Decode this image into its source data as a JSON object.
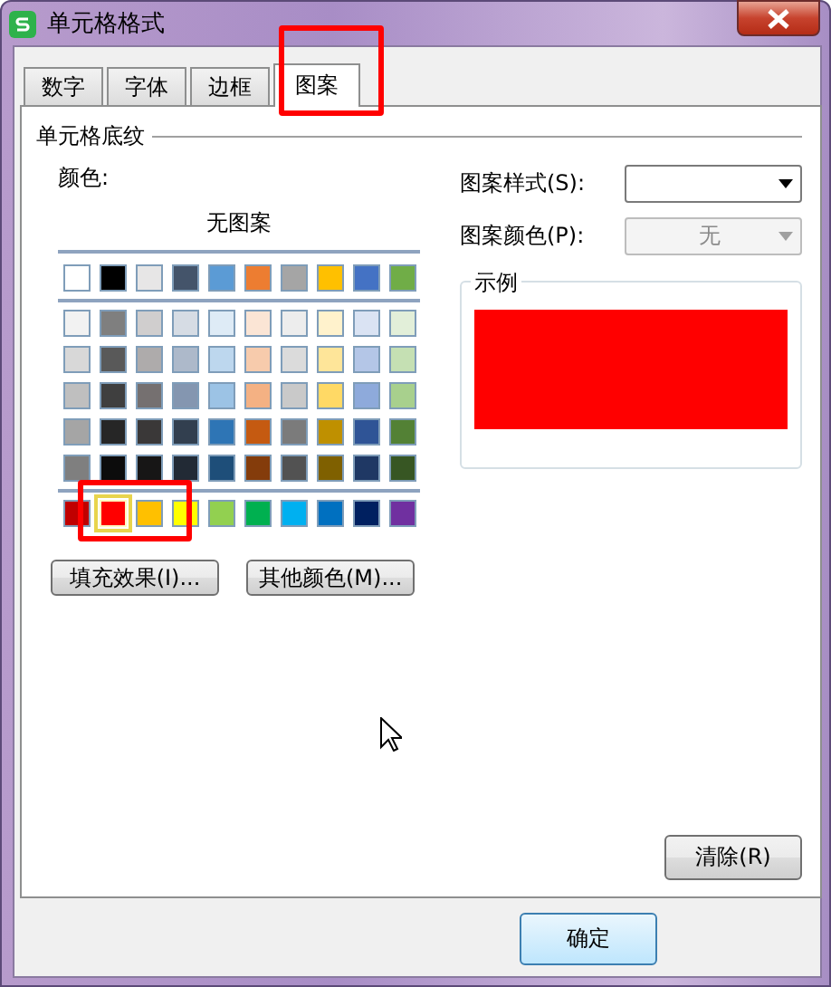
{
  "window": {
    "title": "单元格格式"
  },
  "tabs": [
    {
      "label": "数字",
      "selected": false
    },
    {
      "label": "字体",
      "selected": false
    },
    {
      "label": "边框",
      "selected": false
    },
    {
      "label": "图案",
      "selected": true
    }
  ],
  "shading": {
    "title": "单元格底纹",
    "color_label": "颜色:",
    "no_pattern": "无图案",
    "theme_row": [
      {
        "color": "#ffffff",
        "selected": false
      },
      {
        "color": "#000000",
        "selected": false
      },
      {
        "color": "#e7e6e6",
        "selected": false
      },
      {
        "color": "#44546a",
        "selected": false
      },
      {
        "color": "#5b9bd5",
        "selected": false
      },
      {
        "color": "#ed7d31",
        "selected": false
      },
      {
        "color": "#a5a5a5",
        "selected": false
      },
      {
        "color": "#ffc000",
        "selected": false
      },
      {
        "color": "#4472c4",
        "selected": false
      },
      {
        "color": "#70ad47",
        "selected": false
      }
    ],
    "tint_rows": [
      [
        {
          "color": "#f2f2f2",
          "selected": false
        },
        {
          "color": "#7f7f7f",
          "selected": false
        },
        {
          "color": "#d0cece",
          "selected": false
        },
        {
          "color": "#d6dce4",
          "selected": false
        },
        {
          "color": "#deebf6",
          "selected": false
        },
        {
          "color": "#fbe5d5",
          "selected": false
        },
        {
          "color": "#ededed",
          "selected": false
        },
        {
          "color": "#fff2cc",
          "selected": false
        },
        {
          "color": "#dae3f3",
          "selected": false
        },
        {
          "color": "#e2efd9",
          "selected": false
        }
      ],
      [
        {
          "color": "#d8d8d8",
          "selected": false
        },
        {
          "color": "#595959",
          "selected": false
        },
        {
          "color": "#aeabab",
          "selected": false
        },
        {
          "color": "#adb9ca",
          "selected": false
        },
        {
          "color": "#bdd7ee",
          "selected": false
        },
        {
          "color": "#f7cbac",
          "selected": false
        },
        {
          "color": "#dbdbdb",
          "selected": false
        },
        {
          "color": "#fee599",
          "selected": false
        },
        {
          "color": "#b4c6e7",
          "selected": false
        },
        {
          "color": "#c5e0b3",
          "selected": false
        }
      ],
      [
        {
          "color": "#bfbfbf",
          "selected": false
        },
        {
          "color": "#3f3f3f",
          "selected": false
        },
        {
          "color": "#757070",
          "selected": false
        },
        {
          "color": "#8496b0",
          "selected": false
        },
        {
          "color": "#9cc3e5",
          "selected": false
        },
        {
          "color": "#f4b183",
          "selected": false
        },
        {
          "color": "#c9c9c9",
          "selected": false
        },
        {
          "color": "#ffd965",
          "selected": false
        },
        {
          "color": "#8eaadb",
          "selected": false
        },
        {
          "color": "#a8d08d",
          "selected": false
        }
      ],
      [
        {
          "color": "#a5a5a5",
          "selected": false
        },
        {
          "color": "#262626",
          "selected": false
        },
        {
          "color": "#3a3838",
          "selected": false
        },
        {
          "color": "#323f4f",
          "selected": false
        },
        {
          "color": "#2e75b5",
          "selected": false
        },
        {
          "color": "#c55a11",
          "selected": false
        },
        {
          "color": "#7b7b7b",
          "selected": false
        },
        {
          "color": "#bf9000",
          "selected": false
        },
        {
          "color": "#2f5496",
          "selected": false
        },
        {
          "color": "#538135",
          "selected": false
        }
      ],
      [
        {
          "color": "#7f7f7f",
          "selected": false
        },
        {
          "color": "#0c0c0c",
          "selected": false
        },
        {
          "color": "#171616",
          "selected": false
        },
        {
          "color": "#222a35",
          "selected": false
        },
        {
          "color": "#1e4e79",
          "selected": false
        },
        {
          "color": "#843c0b",
          "selected": false
        },
        {
          "color": "#525252",
          "selected": false
        },
        {
          "color": "#7f6000",
          "selected": false
        },
        {
          "color": "#1f3864",
          "selected": false
        },
        {
          "color": "#375623",
          "selected": false
        }
      ]
    ],
    "standard_row": [
      {
        "color": "#c00000",
        "selected": false
      },
      {
        "color": "#ff0000",
        "selected": true
      },
      {
        "color": "#ffc000",
        "selected": false
      },
      {
        "color": "#ffff00",
        "selected": false
      },
      {
        "color": "#92d050",
        "selected": false
      },
      {
        "color": "#00b050",
        "selected": false
      },
      {
        "color": "#00b0f0",
        "selected": false
      },
      {
        "color": "#0070c0",
        "selected": false
      },
      {
        "color": "#002060",
        "selected": false
      },
      {
        "color": "#7030a0",
        "selected": false
      }
    ],
    "buttons": [
      "填充效果(I)...",
      "其他颜色(M)..."
    ]
  },
  "pattern_style": {
    "label": "图案样式(S):"
  },
  "pattern_color": {
    "label": "图案颜色(P):",
    "value": "无",
    "disabled": true
  },
  "sample": {
    "title": "示例"
  },
  "clear_button": "清除(R)",
  "ok_button": "确定"
}
